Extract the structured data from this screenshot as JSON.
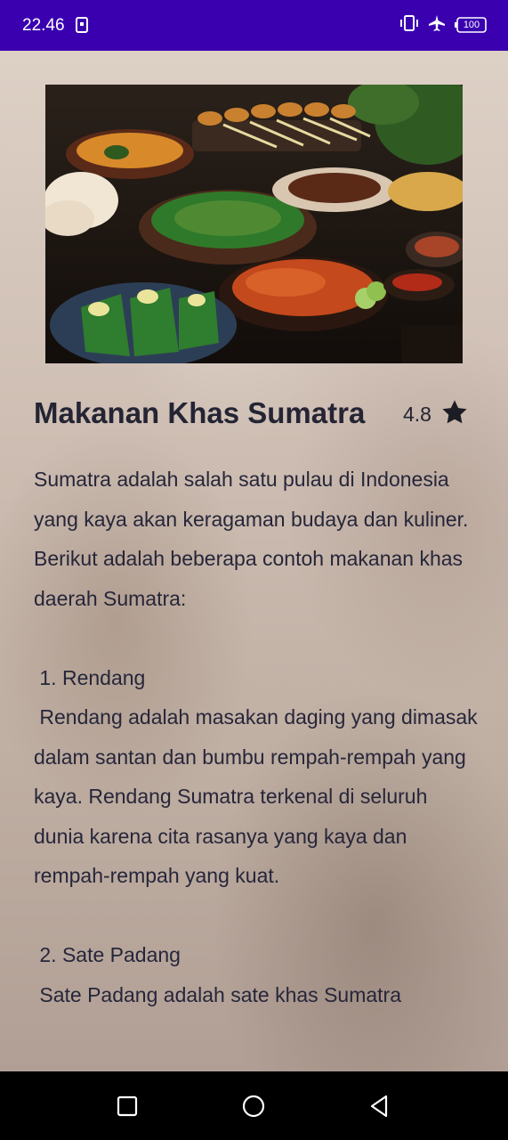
{
  "status_bar": {
    "time": "22.46",
    "battery": "100",
    "icons": [
      "sim-status-icon",
      "vibrate-icon",
      "airplane-mode-icon",
      "battery-icon"
    ]
  },
  "hero_image": {
    "description_icon": "indonesian-food-photo"
  },
  "article": {
    "title": "Makanan Khas Sumatra",
    "rating": "4.8",
    "rating_icon": "star-icon",
    "body": "Sumatra adalah salah satu pulau di Indonesia yang kaya akan keragaman budaya dan kuliner. Berikut adalah beberapa contoh makanan khas daerah Sumatra:\n\n 1. Rendang\n Rendang adalah masakan daging yang dimasak dalam santan dan bumbu rempah-rempah yang kaya. Rendang Sumatra terkenal di seluruh dunia karena cita rasanya yang kaya dan rempah-rempah yang kuat.\n\n 2. Sate Padang\n Sate Padang adalah sate khas Sumatra"
  },
  "nav_bar": {
    "icons": [
      "recents-icon",
      "home-icon",
      "back-icon"
    ]
  },
  "colors": {
    "status_bar": "#3a00b0",
    "text": "#242434",
    "nav_bar": "#000000"
  }
}
